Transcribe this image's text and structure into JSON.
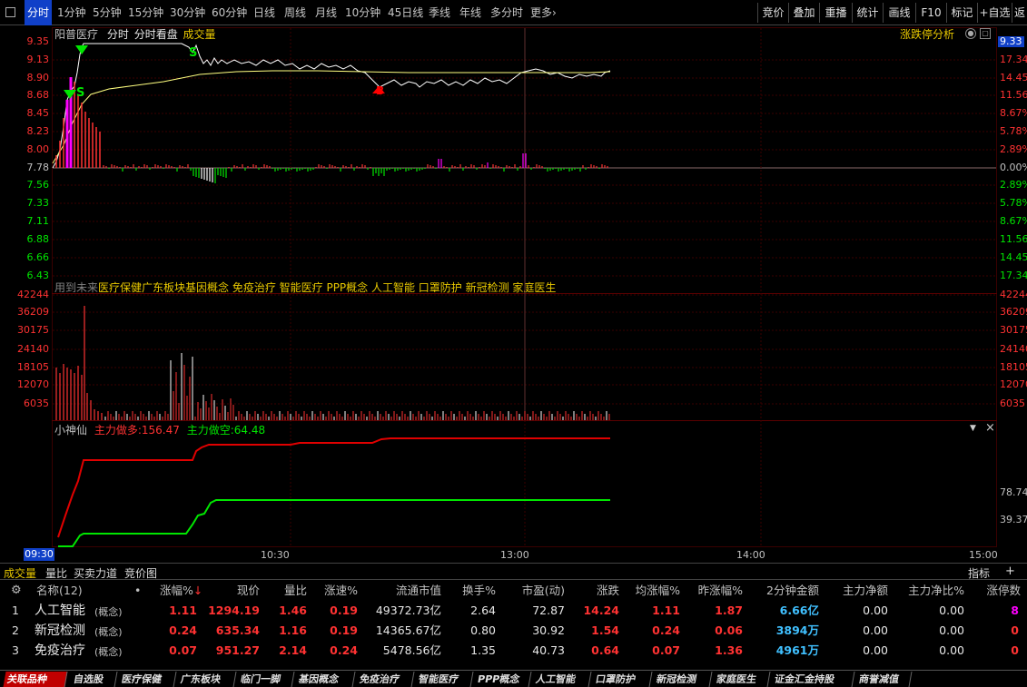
{
  "periods": [
    "分时",
    "1分钟",
    "5分钟",
    "15分钟",
    "30分钟",
    "60分钟",
    "日线",
    "周线",
    "月线",
    "10分钟",
    "45日线",
    "季线",
    "年线",
    "多分时",
    "更多"
  ],
  "right_buttons": [
    "竞价",
    "叠加",
    "重播",
    "统计",
    "画线",
    "F10",
    "标记",
    "+自选",
    "返"
  ],
  "chart_header": {
    "stock": "阳普医疗",
    "mode": "分时",
    "view": "分时看盘",
    "vol": "成交量",
    "zhangdie": "涨跌停分析"
  },
  "price_axis": [
    "9.35",
    "9.13",
    "8.90",
    "8.68",
    "8.45",
    "8.23",
    "8.00",
    "7.78",
    "7.56",
    "7.33",
    "7.11",
    "6.88",
    "6.66",
    "6.43"
  ],
  "pct_axis": [
    "9.33",
    "17.34%",
    "14.45%",
    "11.56%",
    "8.67%",
    "5.78%",
    "2.89%",
    "0.00%",
    "2.89%",
    "5.78%",
    "8.67%",
    "11.56%",
    "14.45%",
    "17.34%"
  ],
  "concept_line": {
    "prefix": "用到未来",
    "text": "医疗保健广东板块基因概念 免疫治疗 智能医疗 PPP概念 人工智能 口罩防护 新冠检测 家庭医生"
  },
  "vol_axis": [
    "42244",
    "36209",
    "30175",
    "24140",
    "18105",
    "12070",
    "6035"
  ],
  "indicator": {
    "name": "小神仙",
    "duo_label": "主力做多:",
    "duo_value": "156.47",
    "kong_label": "主力做空:",
    "kong_value": "64.48",
    "right1": "78.74",
    "right2": "39.37",
    "menu_icon": "▼",
    "close_icon": "×"
  },
  "signals": {
    "s1": "S",
    "s2": "S",
    "s3": "S",
    "b": "B"
  },
  "time_axis": [
    "09:30",
    "10:30",
    "13:00",
    "14:00",
    "15:00"
  ],
  "table_tabs": [
    "成交量",
    "量比",
    "买卖力道",
    "竞价图"
  ],
  "table_right": {
    "zhibiao": "指标",
    "plus": "+"
  },
  "table_headers": [
    "名称(12)",
    "•",
    "涨幅%",
    "现价",
    "量比",
    "涨速%",
    "流通市值",
    "换手%",
    "市盈(动)",
    "涨跌",
    "均涨幅%",
    "昨涨幅%",
    "2分钟金额",
    "主力净额",
    "主力净比%",
    "涨停数"
  ],
  "rows": [
    {
      "idx": "1",
      "name": "人工智能",
      "tag": "(概念)",
      "zf": "1.11",
      "xj": "1294.19",
      "lb": "1.46",
      "zs": "0.19",
      "ltsz": "49372.73亿",
      "hs": "2.64",
      "syl": "72.87",
      "zd": "14.24",
      "jzf": "1.11",
      "zzf": "1.87",
      "je": "6.66亿",
      "zljе": "0.00",
      "zljb": "0.00",
      "zts": "8"
    },
    {
      "idx": "2",
      "name": "新冠检测",
      "tag": "(概念)",
      "zf": "0.24",
      "xj": "635.34",
      "lb": "1.16",
      "zs": "0.19",
      "ltsz": "14365.67亿",
      "hs": "0.80",
      "syl": "30.92",
      "zd": "1.54",
      "jzf": "0.24",
      "zzf": "0.06",
      "je": "3894万",
      "zljе": "0.00",
      "zljb": "0.00",
      "zts": "0"
    },
    {
      "idx": "3",
      "name": "免疫治疗",
      "tag": "(概念)",
      "zf": "0.07",
      "xj": "951.27",
      "lb": "2.14",
      "zs": "0.24",
      "ltsz": "5478.56亿",
      "hs": "1.35",
      "syl": "40.73",
      "zd": "0.64",
      "jzf": "0.07",
      "zzf": "1.36",
      "je": "4961万",
      "zljе": "0.00",
      "zljb": "0.00",
      "zts": "0"
    }
  ],
  "bottom_tabs": [
    "关联品种",
    "自选股",
    "医疗保健",
    "广东板块",
    "临门一脚",
    "基因概念",
    "免疫治疗",
    "智能医疗",
    "PPP概念",
    "人工智能",
    "口罩防护",
    "新冠检测",
    "家庭医生",
    "证金汇金持股",
    "商誉减值"
  ],
  "colors": {
    "up": "#ff3232",
    "down": "#00e600",
    "yellow": "#e8c800",
    "price": "#ffffff",
    "avg": "#ffff80",
    "magenta": "#ff00ff",
    "cyan": "#40c0ff"
  }
}
